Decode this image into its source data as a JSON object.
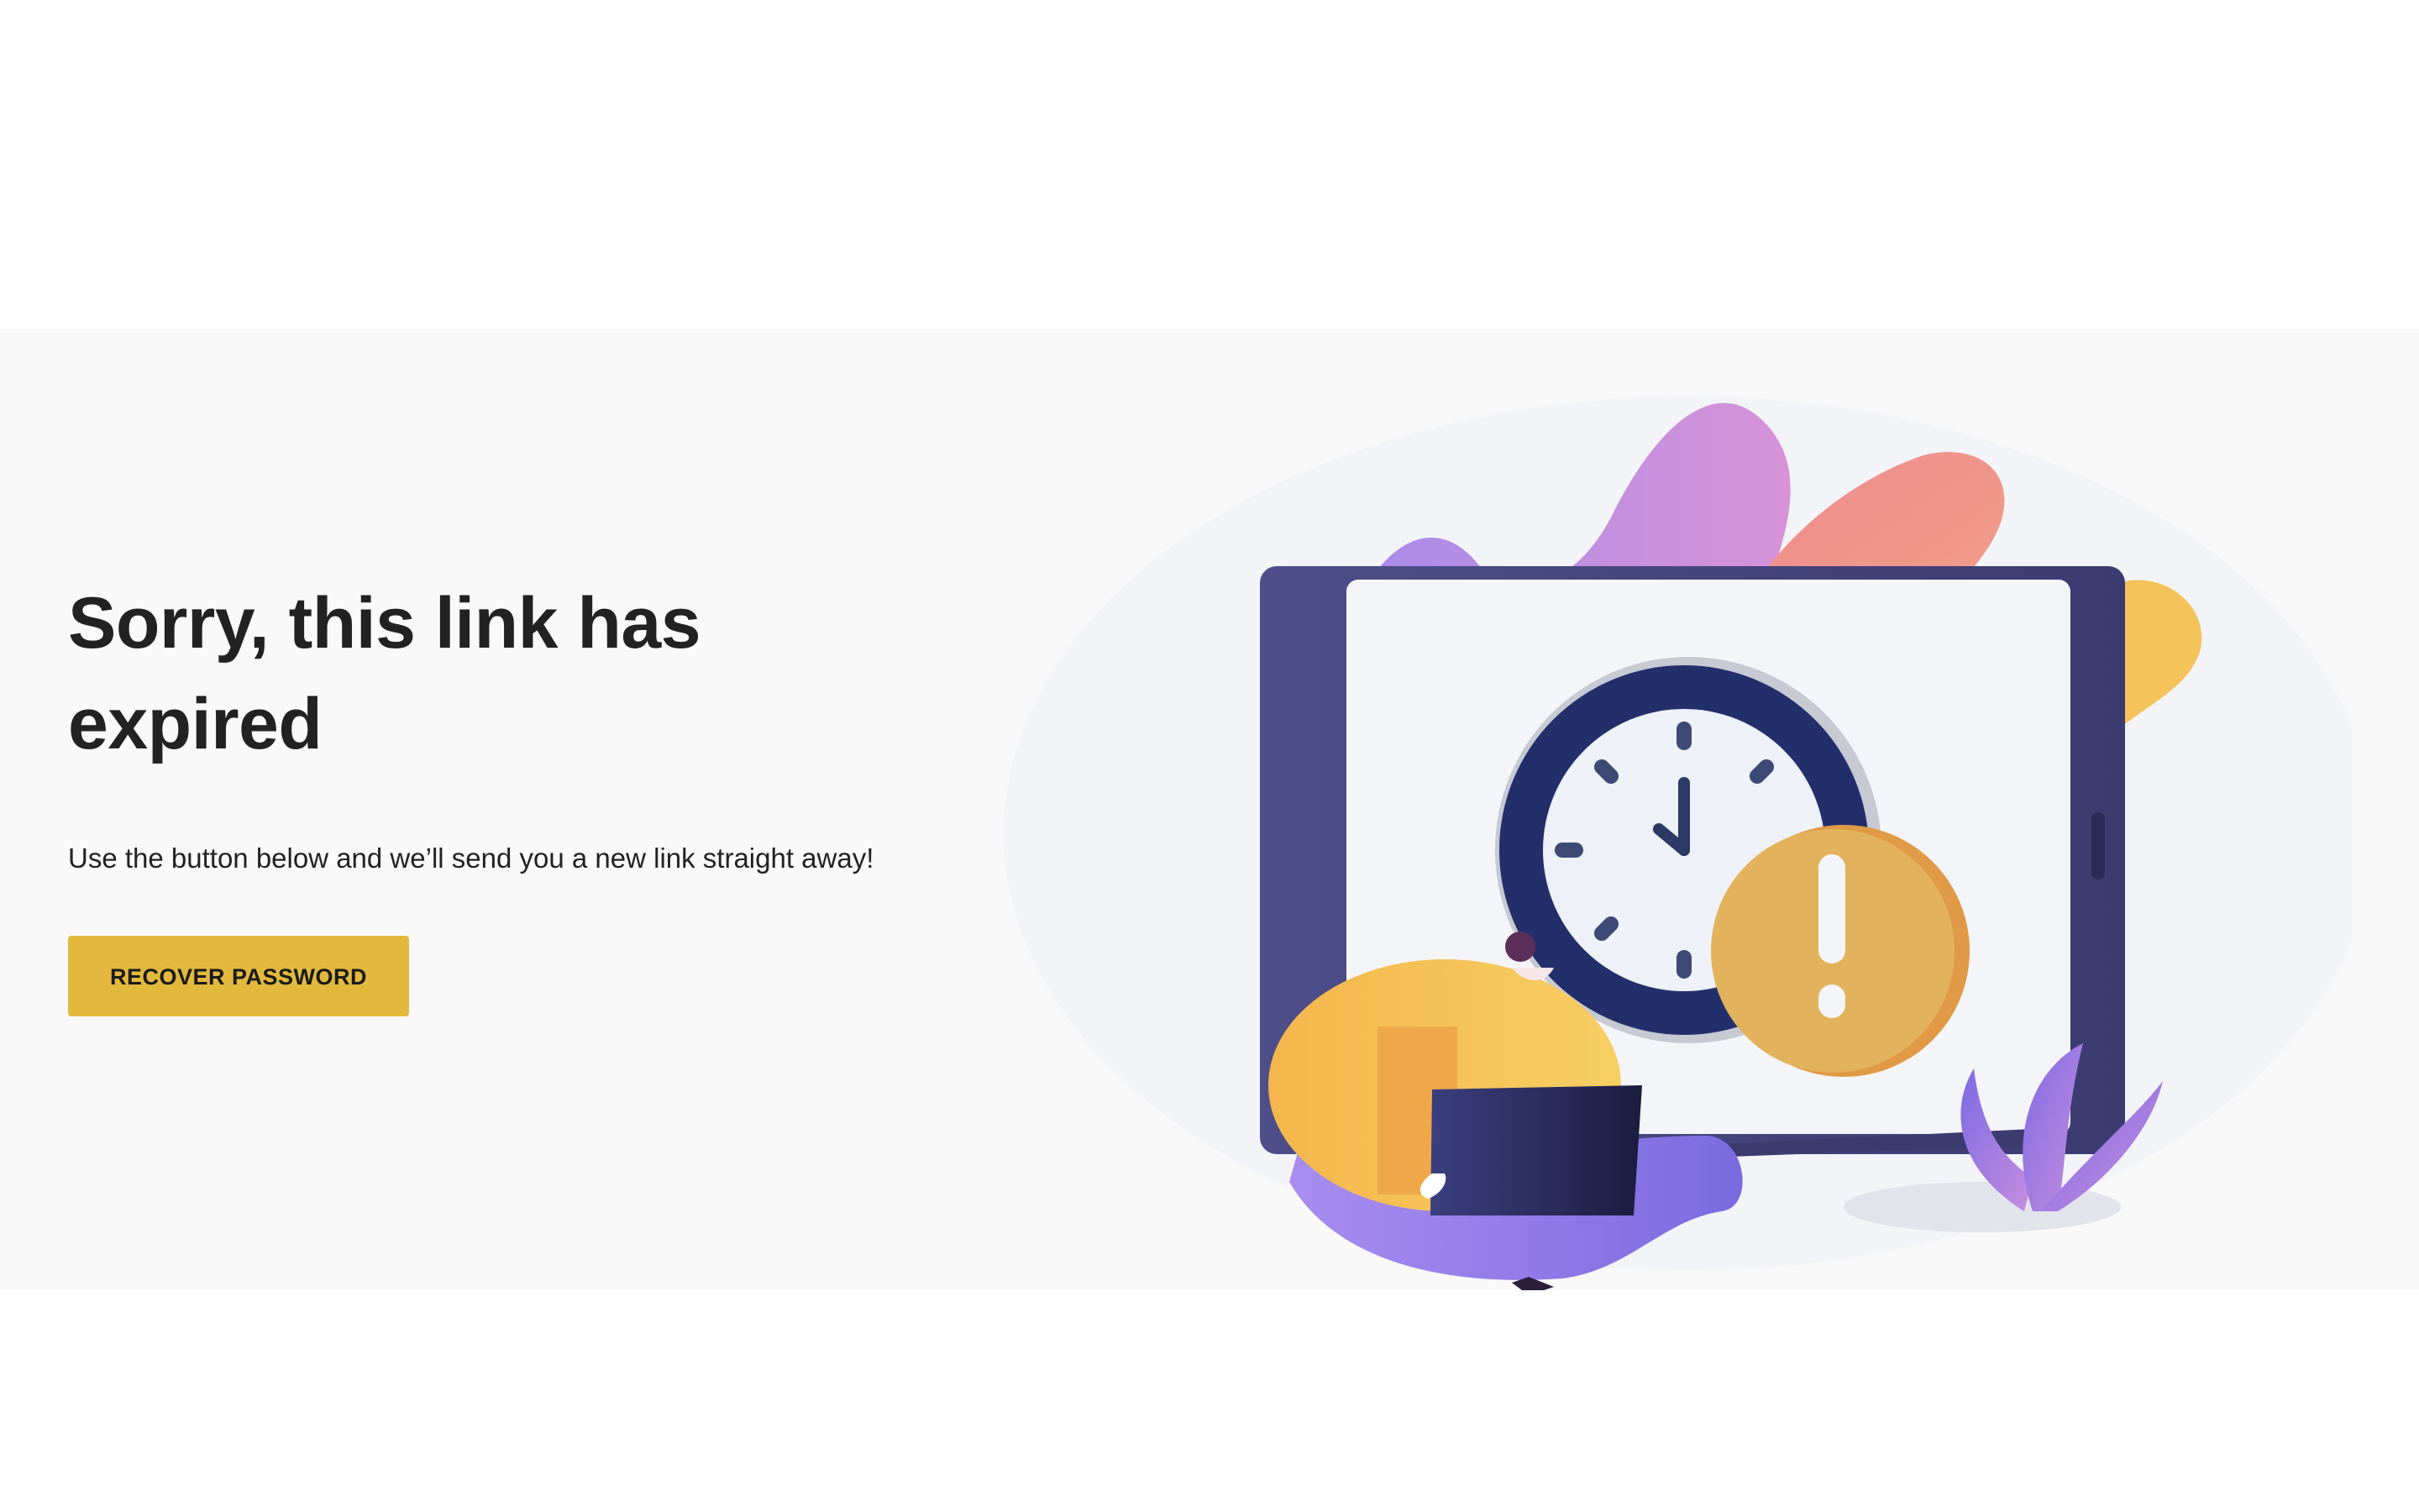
{
  "expired": {
    "title": "Sorry, this link has expired",
    "message": "Use the button below and we’ll send you a new link straight away!",
    "button_label": "RECOVER PASSWORD"
  },
  "illustration": {
    "icons": [
      "clock-icon",
      "exclamation-icon",
      "tablet-icon",
      "laptop-icon",
      "person-icon",
      "leaf-icon"
    ]
  },
  "colors": {
    "accent": "#e2b93c",
    "band_background": "#f9f9f9",
    "text": "#222222"
  }
}
